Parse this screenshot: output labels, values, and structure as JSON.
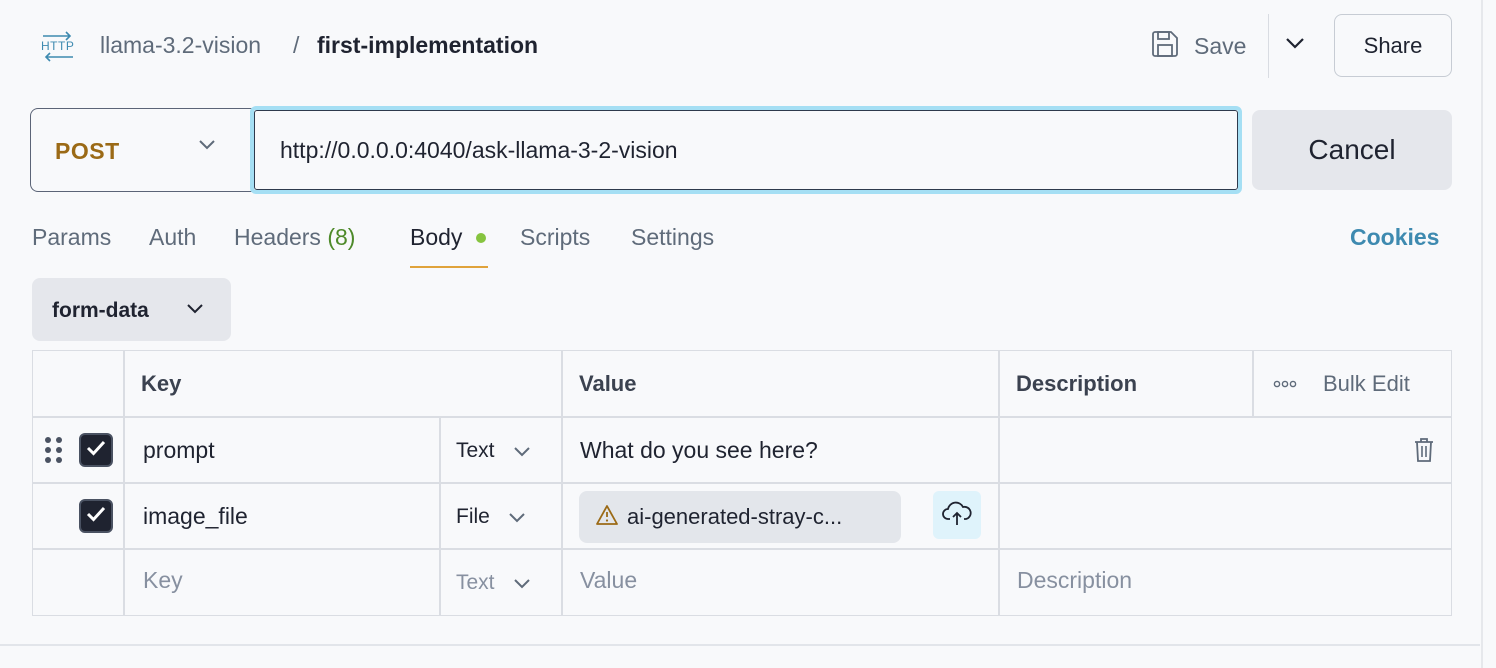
{
  "header": {
    "protocol_icon": "http-icon",
    "breadcrumb_parent": "llama-3.2-vision",
    "breadcrumb_separator": "/",
    "breadcrumb_current": "first-implementation",
    "save_label": "Save",
    "share_label": "Share"
  },
  "request": {
    "method": "POST",
    "url": "http://0.0.0.0:4040/ask-llama-3-2-vision",
    "cancel_label": "Cancel"
  },
  "tabs": {
    "params": "Params",
    "auth": "Auth",
    "headers": "Headers",
    "headers_count": "(8)",
    "body": "Body",
    "scripts": "Scripts",
    "settings": "Settings",
    "cookies": "Cookies",
    "active": "Body"
  },
  "body_mode": "form-data",
  "table": {
    "headers": {
      "key": "Key",
      "value": "Value",
      "description": "Description",
      "bulk_edit": "Bulk Edit"
    },
    "rows": [
      {
        "key": "prompt",
        "type": "Text",
        "value": "What do you see here?",
        "description": "",
        "checked": true
      },
      {
        "key": "image_file",
        "type": "File",
        "value": "ai-generated-stray-c...",
        "description": "",
        "checked": true
      }
    ],
    "new_row": {
      "key_placeholder": "Key",
      "type": "Text",
      "value_placeholder": "Value",
      "description_placeholder": "Description"
    }
  },
  "colors": {
    "method": "#9b6a16",
    "accent_underline": "#e0a33b",
    "body_dot": "#86c43f",
    "cookies": "#3e8ab0",
    "url_focus": "#a5dff4"
  }
}
